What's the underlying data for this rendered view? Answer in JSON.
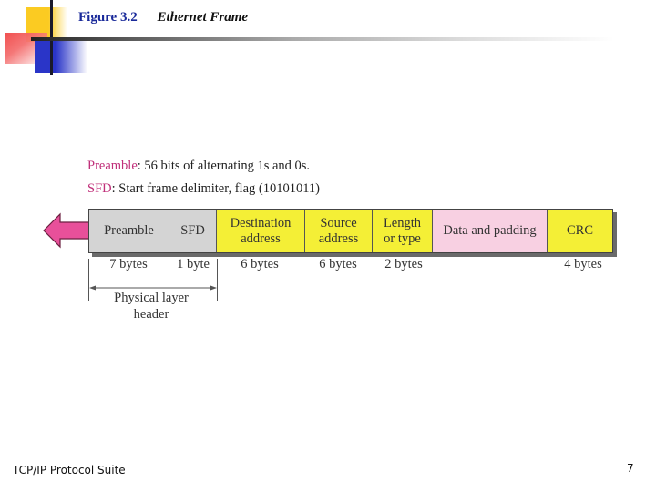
{
  "header": {
    "figure_label": "Figure 3.2",
    "figure_title": "Ethernet Frame"
  },
  "legend": [
    {
      "term": "Preamble",
      "definition": ": 56 bits of alternating 1s and 0s."
    },
    {
      "term": "SFD",
      "definition": ": Start frame delimiter, flag (10101011)"
    }
  ],
  "frame": {
    "fields": [
      {
        "label_line1": "Preamble",
        "label_line2": "",
        "size": "7 bytes"
      },
      {
        "label_line1": "SFD",
        "label_line2": "",
        "size": "1 byte"
      },
      {
        "label_line1": "Destination",
        "label_line2": "address",
        "size": "6 bytes"
      },
      {
        "label_line1": "Source",
        "label_line2": "address",
        "size": "6 bytes"
      },
      {
        "label_line1": "Length",
        "label_line2": "or type",
        "size": "2 bytes"
      },
      {
        "label_line1": "Data and padding",
        "label_line2": "",
        "size": ""
      },
      {
        "label_line1": "CRC",
        "label_line2": "",
        "size": "4 bytes"
      }
    ],
    "colors": {
      "physical_header": "#d4d4d4",
      "address_fields": "#f4ef36",
      "data": "#f8d0e2",
      "arrow": "#e8509a",
      "legend_term": "#c0307a"
    },
    "direction_arrow": "left-arrow-icon",
    "physical_header_label_line1": "Physical layer",
    "physical_header_label_line2": "header"
  },
  "footer": {
    "left_text": "TCP/IP Protocol Suite",
    "page_number": "7"
  }
}
